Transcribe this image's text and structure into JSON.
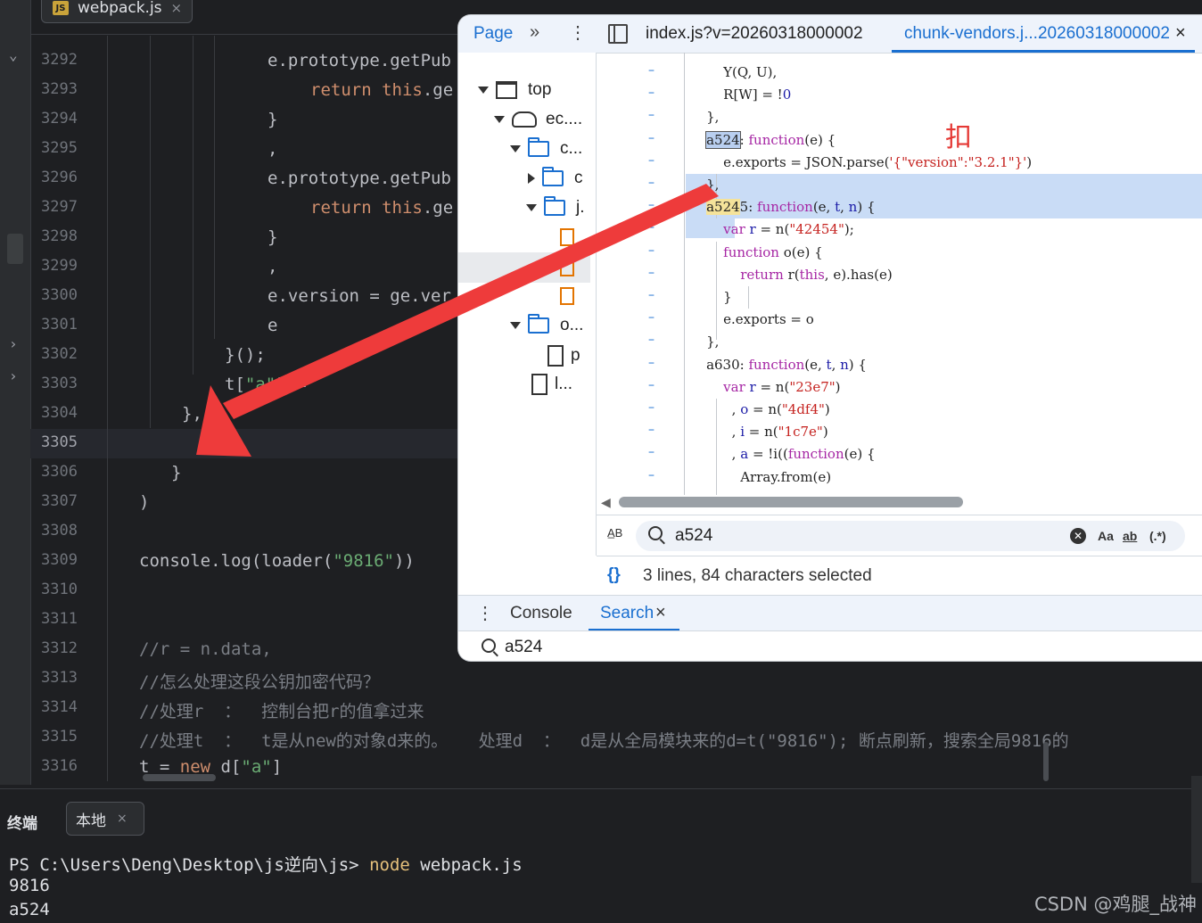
{
  "editor": {
    "tab": {
      "badge": "JS",
      "name": "webpack.js",
      "close": "×"
    },
    "lines": [
      {
        "n": "3292",
        "segs": [
          {
            "t": "e.prototype.getPub",
            "c": ""
          }
        ]
      },
      {
        "n": "3293",
        "segs": [
          {
            "t": "return ",
            "c": "kw"
          },
          {
            "t": "this",
            "c": "kw"
          },
          {
            "t": ".ge",
            "c": ""
          }
        ]
      },
      {
        "n": "3294",
        "segs": [
          {
            "t": "}",
            "c": ""
          }
        ]
      },
      {
        "n": "3295",
        "segs": [
          {
            "t": ",",
            "c": ""
          }
        ]
      },
      {
        "n": "3296",
        "segs": [
          {
            "t": "e.prototype.getPub",
            "c": ""
          }
        ]
      },
      {
        "n": "3297",
        "segs": [
          {
            "t": "return ",
            "c": "kw"
          },
          {
            "t": "this",
            "c": "kw"
          },
          {
            "t": ".ge",
            "c": ""
          }
        ]
      },
      {
        "n": "3298",
        "segs": [
          {
            "t": "}",
            "c": ""
          }
        ]
      },
      {
        "n": "3299",
        "segs": [
          {
            "t": ",",
            "c": ""
          }
        ]
      },
      {
        "n": "3300",
        "segs": [
          {
            "t": "e.version = ge.ver",
            "c": ""
          }
        ]
      },
      {
        "n": "3301",
        "segs": [
          {
            "t": "e",
            "c": ""
          }
        ]
      },
      {
        "n": "3302",
        "segs": [
          {
            "t": "}();",
            "c": ""
          }
        ]
      },
      {
        "n": "3303",
        "segs": [
          {
            "t": "t[",
            "c": ""
          },
          {
            "t": "\"a\"",
            "c": "str"
          },
          {
            "t": "] =",
            "c": ""
          }
        ]
      },
      {
        "n": "3304",
        "segs": [
          {
            "t": "},",
            "c": ""
          }
        ]
      },
      {
        "n": "3305",
        "segs": []
      },
      {
        "n": "3306",
        "segs": [
          {
            "t": "}",
            "c": ""
          }
        ]
      },
      {
        "n": "3307",
        "segs": [
          {
            "t": ")",
            "c": ""
          }
        ]
      },
      {
        "n": "3308",
        "segs": []
      },
      {
        "n": "3309",
        "segs": [
          {
            "t": "console.log(loader(",
            "c": ""
          },
          {
            "t": "\"9816\"",
            "c": "str"
          },
          {
            "t": "))",
            "c": ""
          }
        ]
      },
      {
        "n": "3310",
        "segs": []
      },
      {
        "n": "3311",
        "segs": []
      },
      {
        "n": "3312",
        "segs": [
          {
            "t": "//r = n.data,",
            "c": "com"
          }
        ]
      },
      {
        "n": "3313",
        "segs": [
          {
            "t": "//怎么处理这段公钥加密代码？",
            "c": "com"
          }
        ]
      },
      {
        "n": "3314",
        "segs": [
          {
            "t": "//处理r  ：  控制台把r的值拿过来",
            "c": "com"
          }
        ]
      },
      {
        "n": "3315",
        "segs": [
          {
            "t": "//处理t  ：  t是从new的对象d来的。   处理d  ：  d是从全局模块来的d=t(\"9816\"); 断点刷新，搜索全局9816的",
            "c": "com"
          }
        ]
      },
      {
        "n": "3316",
        "segs": [
          {
            "t": "t = ",
            "c": ""
          },
          {
            "t": "new ",
            "c": "kw"
          },
          {
            "t": "d[",
            "c": ""
          },
          {
            "t": "\"a\"",
            "c": "str"
          },
          {
            "t": "]",
            "c": ""
          }
        ]
      }
    ]
  },
  "terminal": {
    "title": "终端",
    "tab": "本地",
    "tab_close": "×",
    "prompt": "PS C:\\Users\\Deng\\Desktop\\js逆向\\js> ",
    "cmd_node": "node",
    "cmd_rest": " webpack.js",
    "out1": "9816",
    "out2": "a524"
  },
  "watermark": "CSDN @鸡腿_战神",
  "devtools": {
    "page_tab": "Page",
    "more": "»",
    "kebab": "⋮",
    "file1": "index.js?v=20260318000002",
    "file2": "chunk-vendors.j...20260318000002",
    "file2_close": "×",
    "tree": {
      "top": "top",
      "ec": "ec....",
      "c": "c...",
      "c2": "c",
      "j": "j.",
      "o": "o...",
      "p": "p",
      "l": "l..."
    },
    "annotation": "扣",
    "search_value": "a524",
    "search_opts": {
      "case": "Aa",
      "word": "ab",
      "regex": "(.*)"
    },
    "status": "3 lines, 84 characters selected",
    "drawer": {
      "console": "Console",
      "search": "Search",
      "close": "×",
      "query": "a524"
    }
  },
  "source": {
    "lines": [
      {
        "segs": [
          {
            "t": "        Y(Q, U),",
            "c": ""
          }
        ]
      },
      {
        "segs": [
          {
            "t": "        R[W] = !",
            "c": ""
          },
          {
            "t": "0",
            "c": "num"
          }
        ]
      },
      {
        "segs": [
          {
            "t": "    },",
            "c": ""
          }
        ]
      },
      {
        "segs": [
          {
            "t": "    ",
            "c": ""
          },
          {
            "t": "a524",
            "c": "hlbox"
          },
          {
            "t": ": ",
            "c": ""
          },
          {
            "t": "function",
            "c": "kw"
          },
          {
            "t": "(e) {",
            "c": ""
          }
        ]
      },
      {
        "segs": [
          {
            "t": "        e.exports = JSON.parse(",
            "c": ""
          },
          {
            "t": "'{\"version\":\"3.2.1\"}'",
            "c": "str"
          },
          {
            "t": ")",
            "c": ""
          }
        ]
      },
      {
        "segs": [
          {
            "t": "    },",
            "c": ""
          }
        ]
      },
      {
        "segs": [
          {
            "t": "    ",
            "c": ""
          },
          {
            "t": "a524",
            "c": "hl"
          },
          {
            "t": "5: ",
            "c": ""
          },
          {
            "t": "function",
            "c": "kw"
          },
          {
            "t": "(e, ",
            "c": ""
          },
          {
            "t": "t",
            "c": "num"
          },
          {
            "t": ", ",
            "c": ""
          },
          {
            "t": "n",
            "c": "num"
          },
          {
            "t": ") {",
            "c": ""
          }
        ]
      },
      {
        "segs": [
          {
            "t": "        ",
            "c": ""
          },
          {
            "t": "var",
            "c": "kw"
          },
          {
            "t": " ",
            "c": ""
          },
          {
            "t": "r",
            "c": "num"
          },
          {
            "t": " = n(",
            "c": ""
          },
          {
            "t": "\"42454\"",
            "c": "str"
          },
          {
            "t": ");",
            "c": ""
          }
        ]
      },
      {
        "segs": [
          {
            "t": "        ",
            "c": ""
          },
          {
            "t": "function",
            "c": "kw"
          },
          {
            "t": " o(e) {",
            "c": ""
          }
        ]
      },
      {
        "segs": [
          {
            "t": "            ",
            "c": ""
          },
          {
            "t": "return",
            "c": "kw"
          },
          {
            "t": " r(",
            "c": ""
          },
          {
            "t": "this",
            "c": "kw"
          },
          {
            "t": ", e).has(e)",
            "c": ""
          }
        ]
      },
      {
        "segs": [
          {
            "t": "        }",
            "c": ""
          }
        ]
      },
      {
        "segs": [
          {
            "t": "        e.exports = o",
            "c": ""
          }
        ]
      },
      {
        "segs": [
          {
            "t": "    },",
            "c": ""
          }
        ]
      },
      {
        "segs": [
          {
            "t": "    a630: ",
            "c": ""
          },
          {
            "t": "function",
            "c": "kw"
          },
          {
            "t": "(e, ",
            "c": ""
          },
          {
            "t": "t",
            "c": "num"
          },
          {
            "t": ", ",
            "c": ""
          },
          {
            "t": "n",
            "c": "num"
          },
          {
            "t": ") {",
            "c": ""
          }
        ]
      },
      {
        "segs": [
          {
            "t": "        ",
            "c": ""
          },
          {
            "t": "var",
            "c": "kw"
          },
          {
            "t": " ",
            "c": ""
          },
          {
            "t": "r",
            "c": "num"
          },
          {
            "t": " = n(",
            "c": ""
          },
          {
            "t": "\"23e7\"",
            "c": "str"
          },
          {
            "t": ")",
            "c": ""
          }
        ]
      },
      {
        "segs": [
          {
            "t": "          , ",
            "c": ""
          },
          {
            "t": "o",
            "c": "num"
          },
          {
            "t": " = n(",
            "c": ""
          },
          {
            "t": "\"4df4\"",
            "c": "str"
          },
          {
            "t": ")",
            "c": ""
          }
        ]
      },
      {
        "segs": [
          {
            "t": "          , ",
            "c": ""
          },
          {
            "t": "i",
            "c": "num"
          },
          {
            "t": " = n(",
            "c": ""
          },
          {
            "t": "\"1c7e\"",
            "c": "str"
          },
          {
            "t": ")",
            "c": ""
          }
        ]
      },
      {
        "segs": [
          {
            "t": "          , ",
            "c": ""
          },
          {
            "t": "a",
            "c": "num"
          },
          {
            "t": " = !i((",
            "c": ""
          },
          {
            "t": "function",
            "c": "kw"
          },
          {
            "t": "(e) {",
            "c": ""
          }
        ]
      },
      {
        "segs": [
          {
            "t": "            Array.from(e)",
            "c": ""
          }
        ]
      }
    ]
  }
}
